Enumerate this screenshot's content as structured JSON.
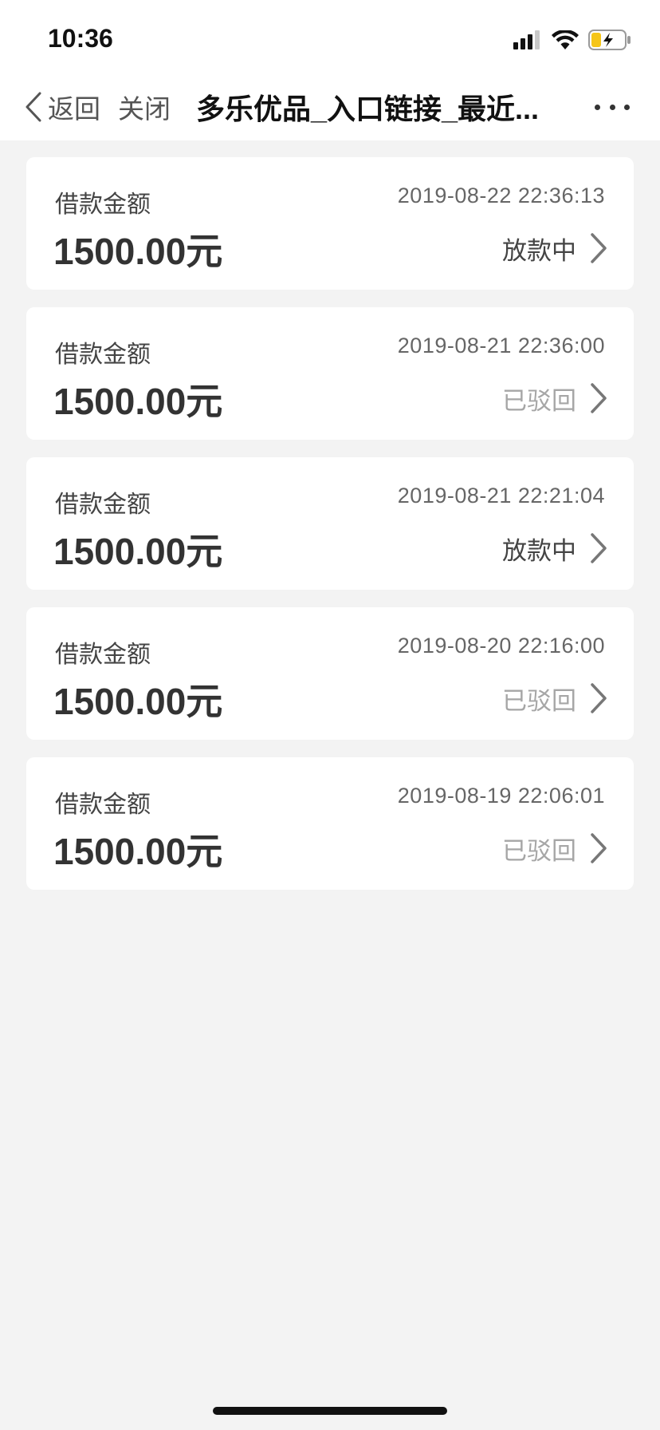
{
  "status_bar": {
    "time": "10:36"
  },
  "nav": {
    "back_label": "返回",
    "close_label": "关闭",
    "title": "多乐优品_入口链接_最近..."
  },
  "loans": [
    {
      "label": "借款金额",
      "time": "2019-08-22 22:36:13",
      "amount": "1500.00元",
      "status": "放款中",
      "status_type": "pending"
    },
    {
      "label": "借款金额",
      "time": "2019-08-21 22:36:00",
      "amount": "1500.00元",
      "status": "已驳回",
      "status_type": "rejected"
    },
    {
      "label": "借款金额",
      "time": "2019-08-21 22:21:04",
      "amount": "1500.00元",
      "status": "放款中",
      "status_type": "pending"
    },
    {
      "label": "借款金额",
      "time": "2019-08-20 22:16:00",
      "amount": "1500.00元",
      "status": "已驳回",
      "status_type": "rejected"
    },
    {
      "label": "借款金额",
      "time": "2019-08-19 22:06:01",
      "amount": "1500.00元",
      "status": "已驳回",
      "status_type": "rejected"
    }
  ],
  "colors": {
    "background": "#f3f3f3",
    "card": "#ffffff",
    "status_pending": "#444444",
    "status_rejected": "#a6a6a6",
    "battery_fill": "#f5c518"
  },
  "icons": {
    "back": "chevron-left-icon",
    "more": "more-dots-icon",
    "row_arrow": "chevron-right-icon",
    "signal": "cellular-signal-icon",
    "wifi": "wifi-icon",
    "battery": "battery-charging-icon"
  }
}
